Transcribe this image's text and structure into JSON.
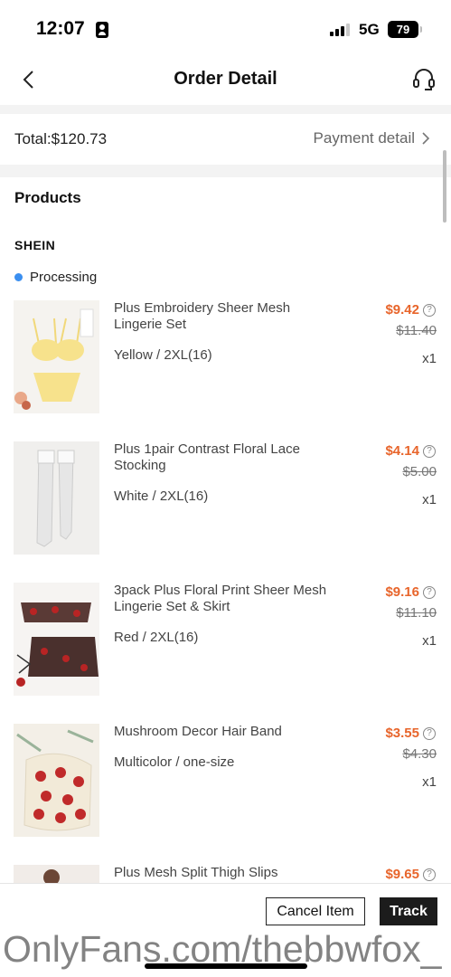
{
  "status_bar": {
    "time": "12:07",
    "network": "5G",
    "battery": "79"
  },
  "nav": {
    "title": "Order Detail"
  },
  "order": {
    "total_label": "Total:$120.73",
    "payment_detail_label": "Payment detail"
  },
  "products_section": {
    "heading": "Products",
    "store": "SHEIN",
    "status": "Processing",
    "items": [
      {
        "name": "Plus Embroidery Sheer Mesh Lingerie Set",
        "variant": "Yellow / 2XL(16)",
        "price": "$9.42",
        "original_price": "$11.40",
        "qty": "x1"
      },
      {
        "name": "Plus 1pair Contrast Floral Lace Stocking",
        "variant": "White / 2XL(16)",
        "price": "$4.14",
        "original_price": "$5.00",
        "qty": "x1"
      },
      {
        "name": "3pack Plus Floral Print Sheer Mesh Lingerie Set & Skirt",
        "variant": "Red / 2XL(16)",
        "price": "$9.16",
        "original_price": "$11.10",
        "qty": "x1"
      },
      {
        "name": "Mushroom Decor Hair Band",
        "variant": "Multicolor / one-size",
        "price": "$3.55",
        "original_price": "$4.30",
        "qty": "x1"
      },
      {
        "name": "Plus Mesh Split Thigh Slips",
        "price": "$9.65"
      }
    ]
  },
  "actions": {
    "cancel_label": "Cancel Item",
    "track_label": "Track"
  },
  "watermark": "OnlyFans.com/thebbwfox_",
  "colors": {
    "price": "#e8652b",
    "status_dot": "#3b8ff0",
    "track_bg": "#1c1c1c"
  },
  "icons": {
    "back": "chevron-left-icon",
    "support": "headset-icon",
    "payment": "chevron-right-icon",
    "price_info": "info-icon"
  }
}
